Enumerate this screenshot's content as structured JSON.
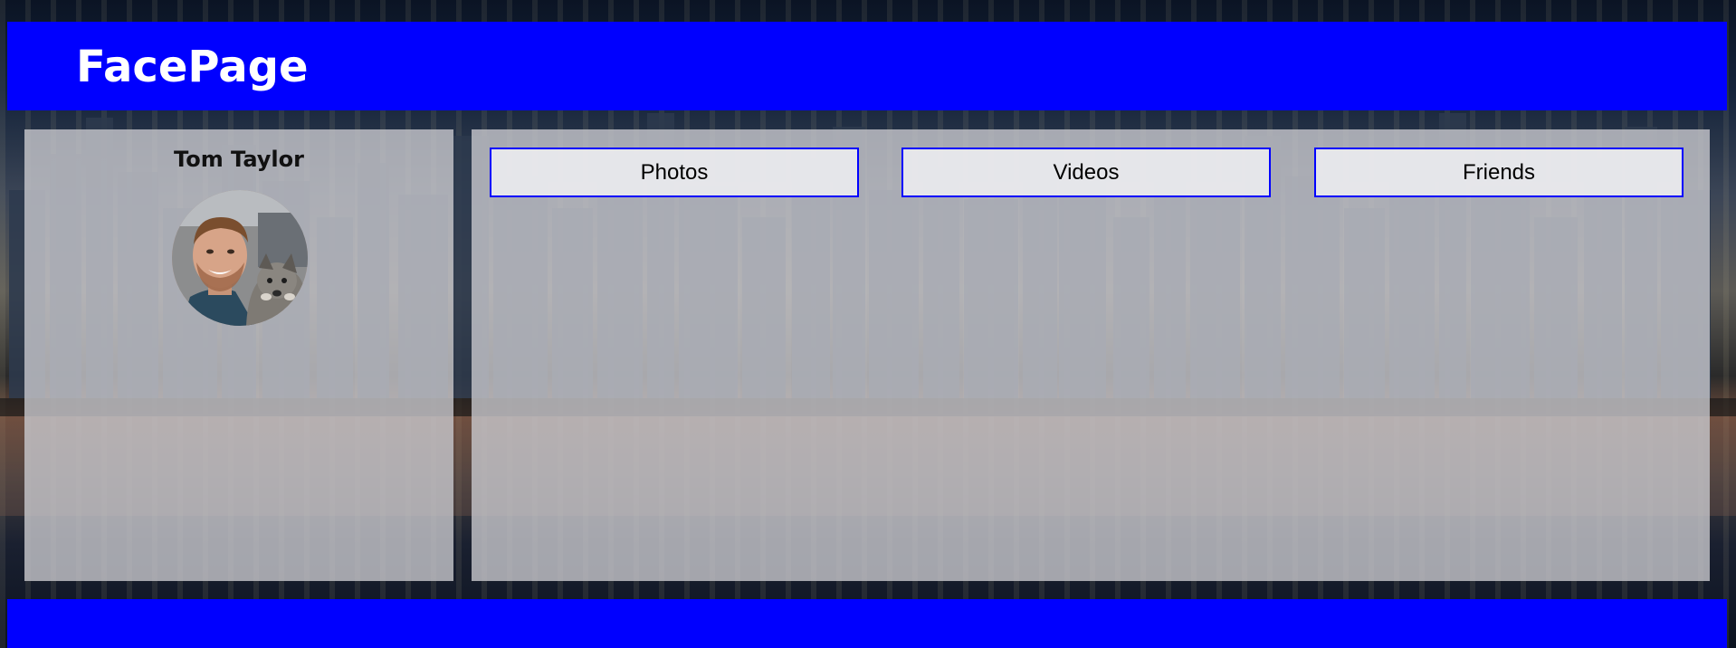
{
  "app": {
    "title": "FacePage"
  },
  "profile": {
    "name": "Tom Taylor",
    "avatar_icon": "profile-photo"
  },
  "nav": {
    "tabs": [
      {
        "label": "Photos"
      },
      {
        "label": "Videos"
      },
      {
        "label": "Friends"
      }
    ]
  },
  "colors": {
    "brand": "#0000ff",
    "panel": "#c8c8cd",
    "text": "#000000",
    "header_text": "#ffffff"
  }
}
